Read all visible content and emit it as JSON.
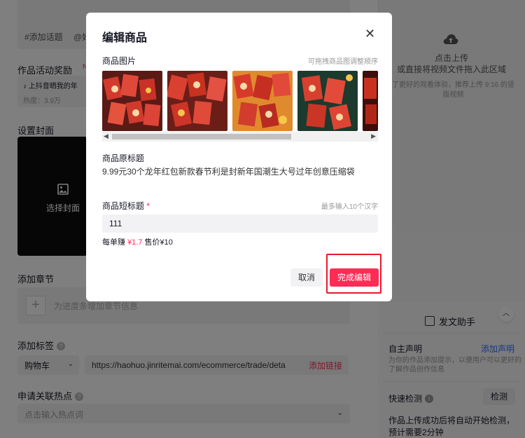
{
  "background": {
    "topics": [
      "#添加话题",
      "@好"
    ],
    "reward_label": "作品活动奖励",
    "reward_badge": "N",
    "reward_card_title": "上抖音晒我的年",
    "reward_card_heat": "热度：3.9万",
    "cover_label": "设置封面",
    "cover_button": "选择封面",
    "chapter_label": "添加章节",
    "chapter_placeholder": "为进度条增加章节信息",
    "tag_label": "添加标签",
    "cart_select": "购物车",
    "link_value": "https://haohuo.jinritemai.com/ecommerce/trade/deta",
    "add_link": "添加链接",
    "hot_label": "申请关联热点",
    "hot_placeholder": "点击输入热点词",
    "upload_title": "点击上传",
    "upload_sub": "或直接将视频文件拖入此区域",
    "upload_tip": "了更好的观看体验，推荐上传 9:16 的竖版视频",
    "helper_title": "发文助手",
    "self_decl": "自主声明",
    "add_decl": "添加声明",
    "decl_tip": "为你的作品添加提示，以便用户可以更好的了解作品创作信息",
    "quick_check": "快速检测",
    "check_button": "检测",
    "check_tip": "作品上传成功后将自动开始检测，预计需要2分钟"
  },
  "modal": {
    "title": "编辑商品",
    "image_label": "商品图片",
    "image_hint": "可拖拽商品图调整顺序",
    "original_title_label": "商品原标题",
    "original_title": "9.99元30个龙年红包新款春节利是封新年国潮生大号过年创意压缩袋",
    "short_title_label": "商品短标题",
    "required_mark": "*",
    "short_title_hint": "最多输入10个汉字",
    "short_title_value": "111",
    "earn_label": "每单赚",
    "earn_value": "¥1.7",
    "price_label": "售价¥10",
    "cancel_button": "取消",
    "done_button": "完成编辑"
  },
  "colors": {
    "accent": "#fe2c55",
    "link": "#3370ff",
    "highlight": "#e8192c"
  }
}
